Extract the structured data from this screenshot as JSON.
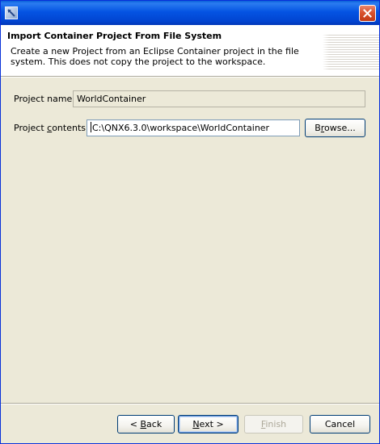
{
  "window": {
    "title": ""
  },
  "banner": {
    "title": "Import Container Project From File System",
    "description": "Create a new Project from an Eclipse Container project in the file system. This does not copy the project to the workspace."
  },
  "form": {
    "project_name_label": "Project name:",
    "project_name_value": "WorldContainer",
    "project_contents_label_pre": "Project ",
    "project_contents_label_u": "c",
    "project_contents_label_post": "ontents:",
    "project_contents_value": "C:\\QNX6.3.0\\workspace\\WorldContainer",
    "browse_pre": "B",
    "browse_u": "r",
    "browse_post": "owse..."
  },
  "footer": {
    "back_arrow": "< ",
    "back_u": "B",
    "back_post": "ack",
    "next_u": "N",
    "next_post": "ext >",
    "finish_u": "F",
    "finish_post": "inish",
    "cancel_label": "Cancel"
  },
  "colors": {
    "titlebar": "#0054e3",
    "dialog_bg": "#ece9d8",
    "close_button": "#d9532f",
    "button_border": "#003c74"
  },
  "icons": {
    "app": "eclipse-window-icon",
    "close": "close-icon"
  }
}
